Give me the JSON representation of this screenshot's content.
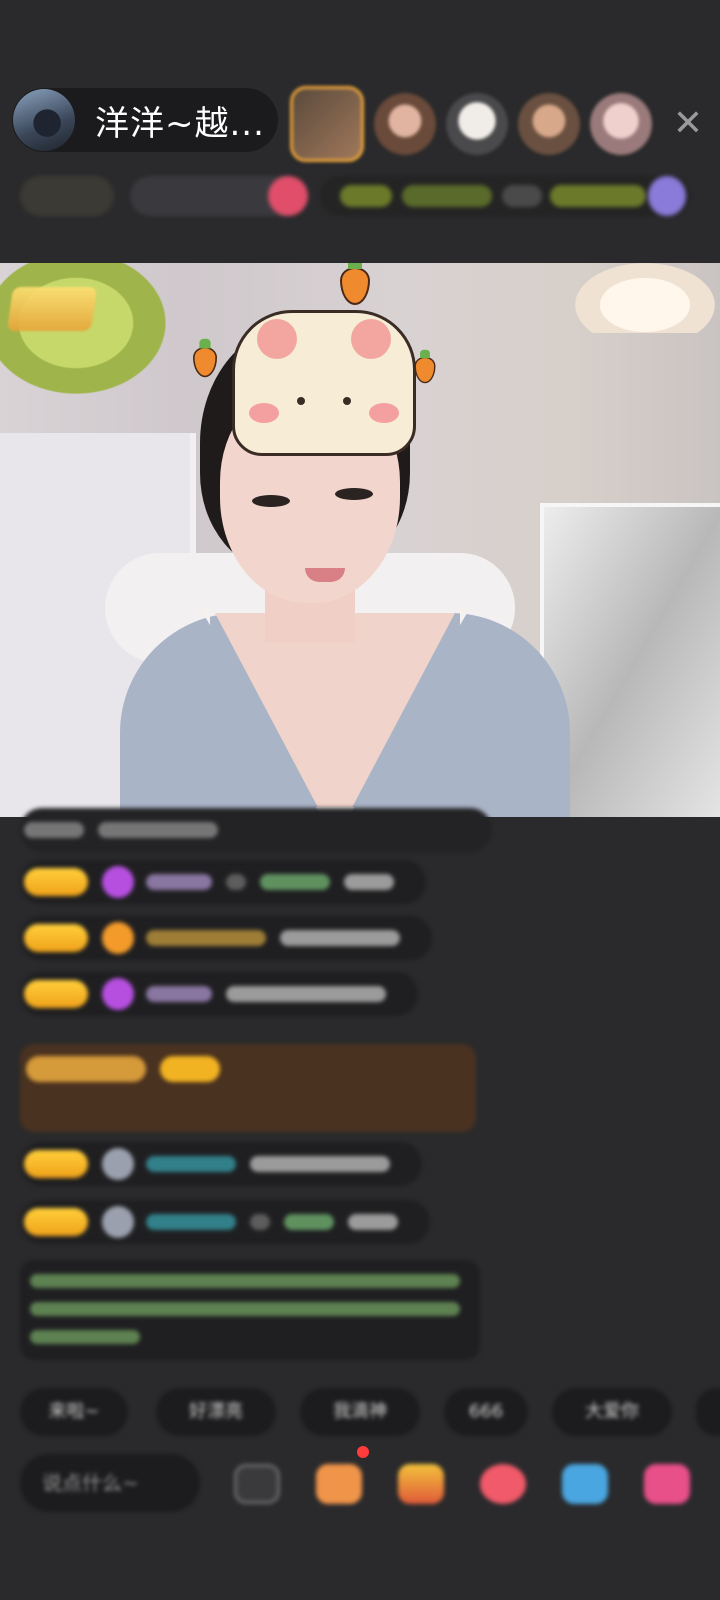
{
  "header": {
    "host_name": "洋洋~越...",
    "close_icon": "close-icon",
    "viewer_colors": [
      "#7a5a3c",
      "#c98a6a",
      "#d9c6b9",
      "#b58a6a",
      "#caa9a6"
    ]
  },
  "badge_colors": [
    "#6a6450",
    "#3d3d3f",
    "#4a5a7a",
    "#e04e6a",
    "#6b7a2a",
    "#5a6a2a",
    "#4a4a4a",
    "#6b7a2a",
    "#8a7ad9"
  ],
  "chat": {
    "colors": {
      "level": "#f2b322",
      "purple_gem": "#b64fe0",
      "orange_gem": "#f39a2a",
      "gray_gem": "#9aa0ad",
      "name_purple": "#b79bd8",
      "name_gold": "#d4a640",
      "name_teal": "#3ba9b8",
      "name_green": "#7ac27a",
      "note_bg": "#4a3220",
      "system_text": "#8fd17a"
    }
  },
  "quick_replies": [
    "来啦~",
    "好漂亮",
    "我滴神",
    "666",
    "大爱你"
  ],
  "composer": {
    "placeholder": "说点什么~"
  },
  "toolbar_colors": [
    "#7a7a7c",
    "#f0944a",
    "#f3c23a",
    "#f05a6a",
    "#4aa6e0",
    "#e8508a"
  ]
}
